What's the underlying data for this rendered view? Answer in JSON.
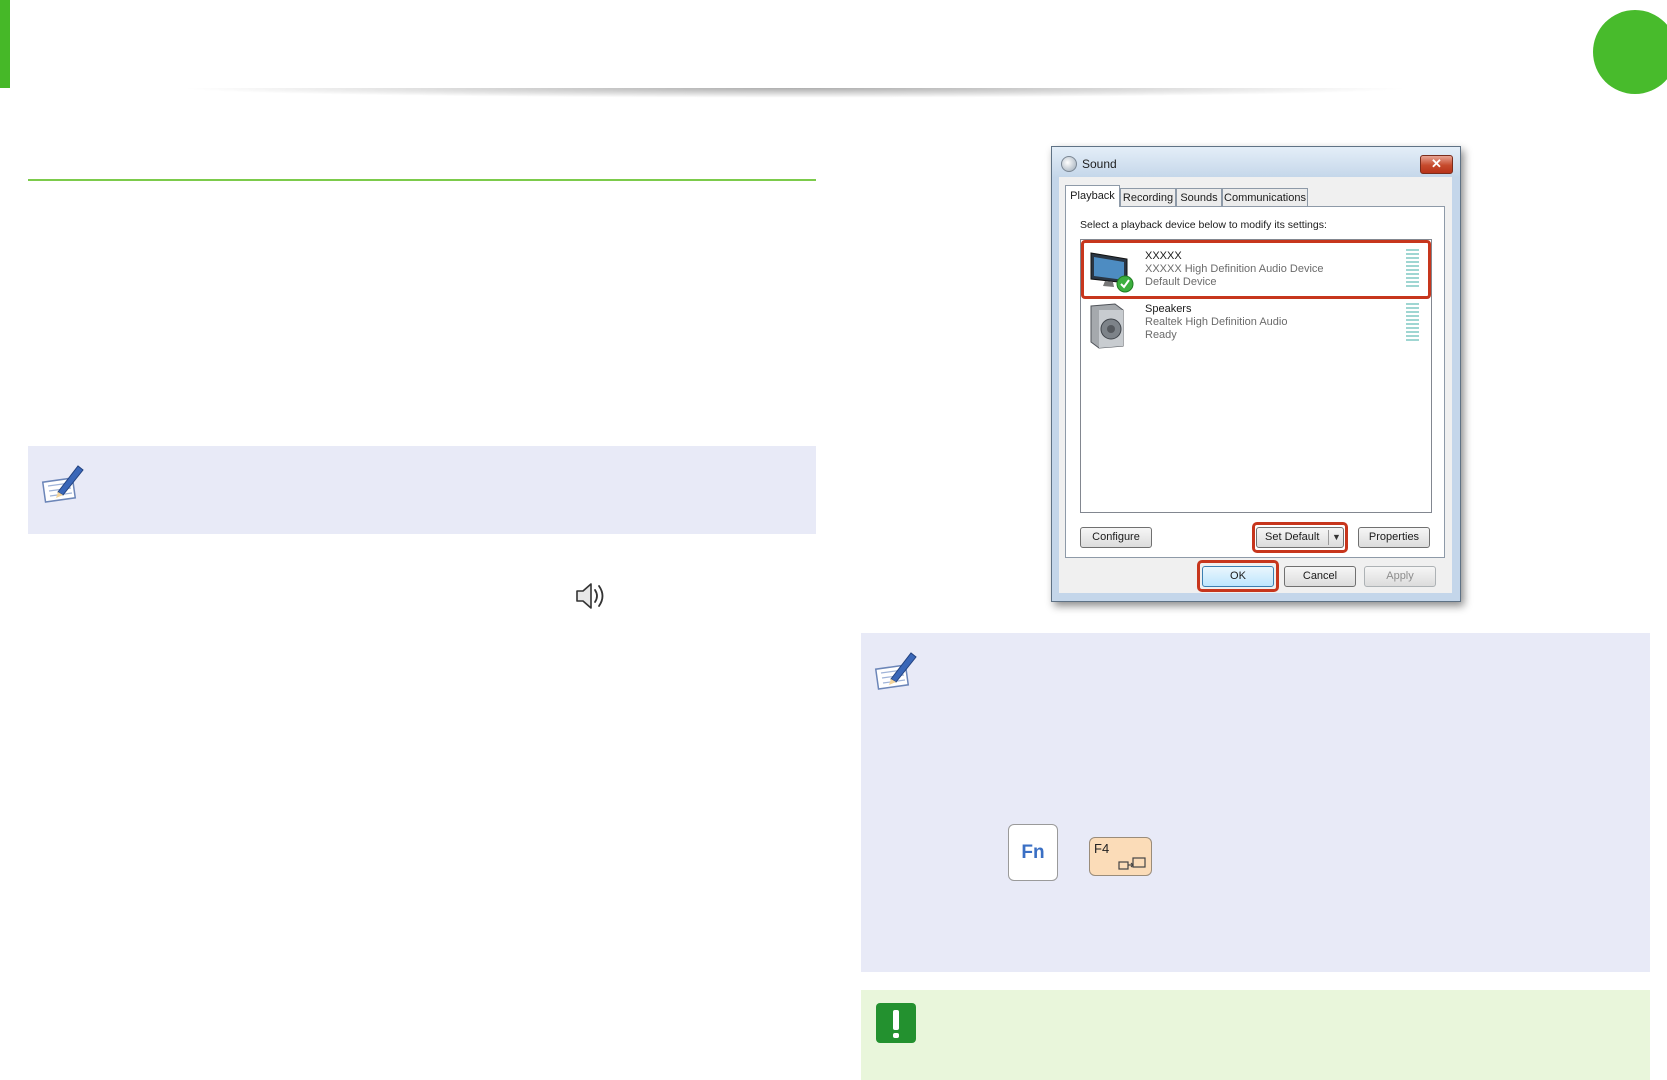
{
  "dialog": {
    "title": "Sound",
    "close_label": "✕",
    "tabs": [
      "Playback",
      "Recording",
      "Sounds",
      "Communications"
    ],
    "instruction": "Select a playback device below to modify its settings:",
    "devices": [
      {
        "name": "XXXXX",
        "description": "XXXXX High Definition Audio Device",
        "status": "Default Device",
        "icon": "monitor-icon"
      },
      {
        "name": "Speakers",
        "description": "Realtek High Definition Audio",
        "status": "Ready",
        "icon": "speaker-icon"
      }
    ],
    "buttons": {
      "configure": "Configure",
      "set_default": "Set Default",
      "properties": "Properties",
      "ok": "OK",
      "cancel": "Cancel",
      "apply": "Apply"
    }
  },
  "keys": {
    "fn": "Fn",
    "f4": "F4"
  },
  "colors": {
    "accent_green": "#46b828",
    "note_bg": "#e8eaf7",
    "warning_bg": "#e9f6db",
    "highlight_red": "#c7361d"
  }
}
